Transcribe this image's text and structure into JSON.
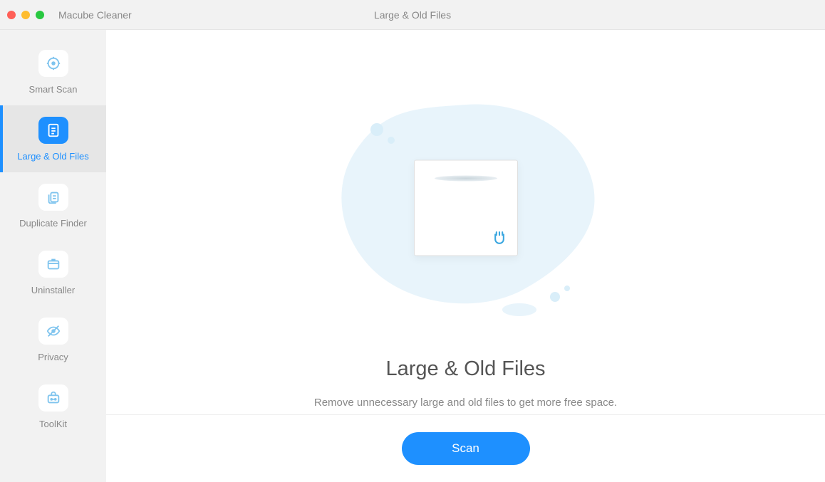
{
  "titlebar": {
    "app_name": "Macube Cleaner",
    "title": "Large & Old Files"
  },
  "sidebar": {
    "items": [
      {
        "label": "Smart Scan"
      },
      {
        "label": "Large & Old Files"
      },
      {
        "label": "Duplicate Finder"
      },
      {
        "label": "Uninstaller"
      },
      {
        "label": "Privacy"
      },
      {
        "label": "ToolKit"
      }
    ]
  },
  "main": {
    "heading": "Large & Old Files",
    "subtitle": "Remove unnecessary large and old files to get more free space.",
    "scan_button": "Scan"
  }
}
